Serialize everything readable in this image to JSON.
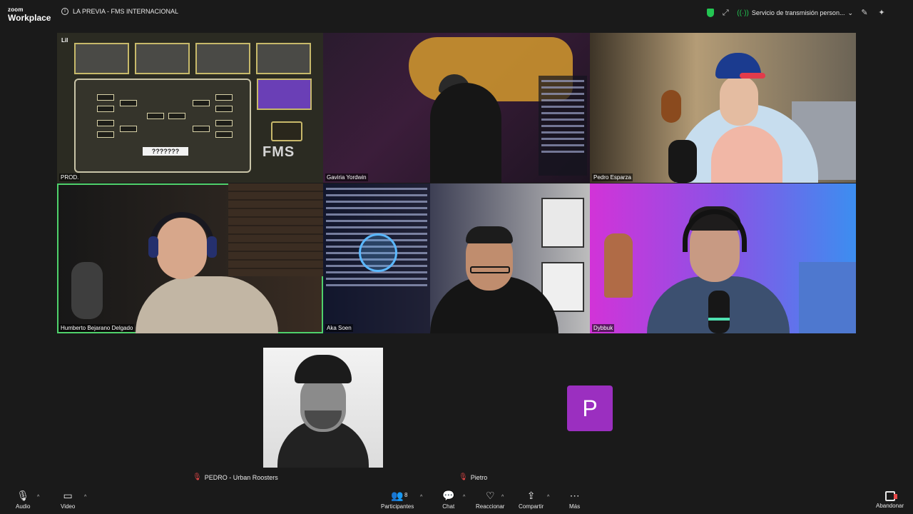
{
  "topbar": {
    "brand_small": "zoom",
    "brand_big": "Workplace",
    "meeting_title": "LA PREVIA - FMS INTERNACIONAL",
    "stream_label": "Servicio de transmisión person...",
    "shield_color": "#23c552"
  },
  "tiles": [
    {
      "name": "PROD.",
      "active": false
    },
    {
      "name": "Gaviria Yordwin",
      "active": false
    },
    {
      "name": "Pedro Esparza",
      "active": false
    },
    {
      "name": "Humberto Bejarano Delgado",
      "active": true
    },
    {
      "name": "Aka Soen",
      "active": false
    },
    {
      "name": "Dybbuk",
      "active": false
    }
  ],
  "tile1_overlay": {
    "corner_logo": "Lil",
    "prize_text": "???????",
    "board_logo": "FMS"
  },
  "bottom_participants": [
    {
      "name": "PEDRO - Urban Roosters",
      "muted": true
    },
    {
      "name": "Pietro",
      "muted": true,
      "avatar_letter": "P",
      "avatar_color": "#9b2fc0"
    }
  ],
  "toolbar": {
    "audio": "Audio",
    "video": "Video",
    "participants": "Participantes",
    "participants_count": "8",
    "chat": "Chat",
    "react": "Reaccionar",
    "share": "Compartir",
    "more": "Más",
    "leave": "Abandonar",
    "active_speaker_color": "#4fd16b",
    "leave_color": "#e64848"
  },
  "icons": {
    "info": "info-icon",
    "shield": "shield-icon",
    "mic": "microphone-icon",
    "camera": "video-camera-icon",
    "people": "participants-icon",
    "chat": "chat-bubble-icon",
    "heart": "heart-icon",
    "share": "share-screen-icon",
    "more": "more-icon",
    "leave": "leave-icon"
  }
}
